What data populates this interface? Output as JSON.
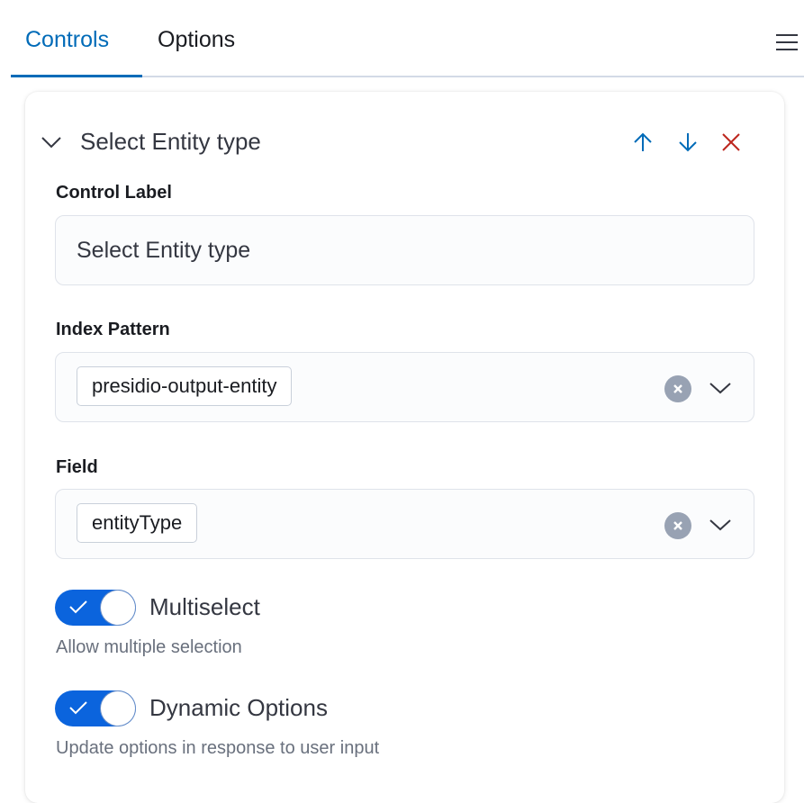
{
  "tabs": {
    "controls": "Controls",
    "options": "Options"
  },
  "icons": {
    "menu": "menu-icon",
    "collapse": "chevron-down-icon",
    "move_up": "arrow-up-icon",
    "move_down": "arrow-down-icon",
    "remove": "close-icon",
    "clear": "clear-icon",
    "dropdown": "chevron-down-icon",
    "check": "check-icon"
  },
  "colors": {
    "accent": "#006bb8",
    "danger": "#bd271e",
    "switch_on": "#0b64dd"
  },
  "panel": {
    "title": "Select Entity type"
  },
  "control_label": {
    "label": "Control Label",
    "value": "Select Entity type"
  },
  "index_pattern": {
    "label": "Index Pattern",
    "value": "presidio-output-entity"
  },
  "field": {
    "label": "Field",
    "value": "entityType"
  },
  "multiselect": {
    "label": "Multiselect",
    "help": "Allow multiple selection",
    "checked": true
  },
  "dynamic_options": {
    "label": "Dynamic Options",
    "help": "Update options in response to user input",
    "checked": true
  }
}
